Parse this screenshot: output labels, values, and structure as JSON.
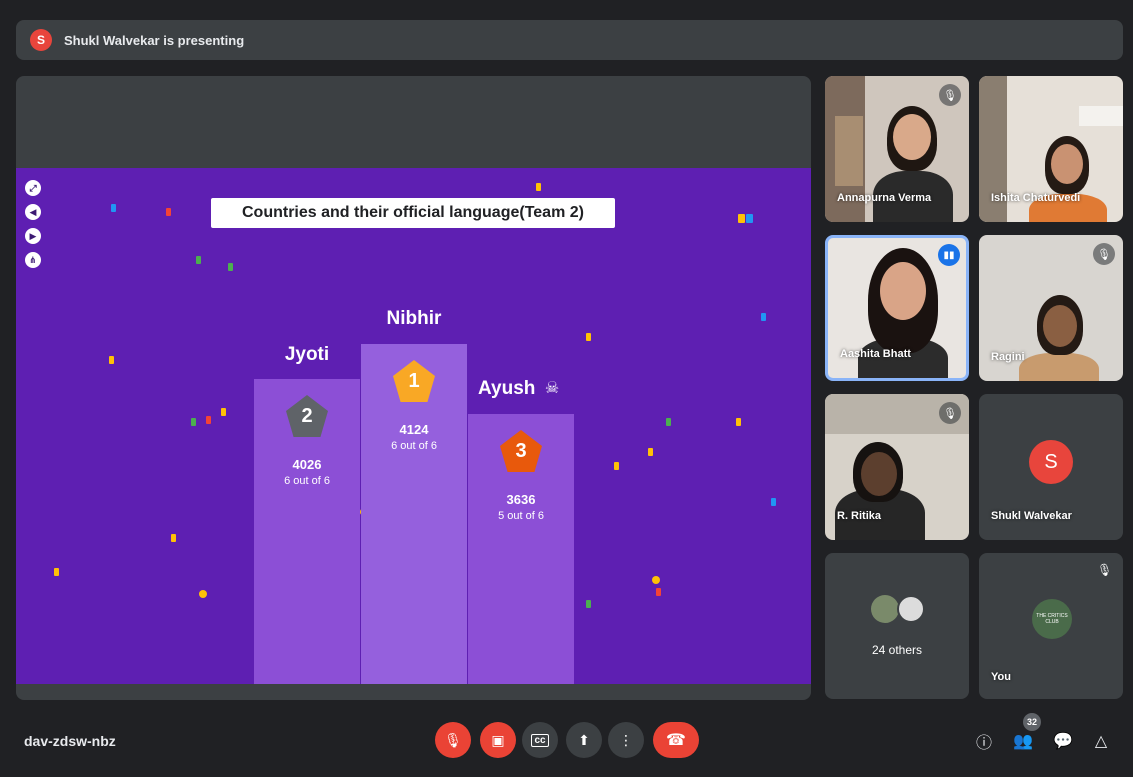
{
  "presenter_bar": {
    "avatar_letter": "S",
    "text": "Shukl Walvekar is presenting"
  },
  "slide": {
    "title": "Countries and their official language(Team 2)",
    "controls": [
      "fullscreen-icon",
      "prev-icon",
      "next-icon",
      "share-icon"
    ],
    "podium": [
      {
        "rank": "2",
        "name": "Jyoti",
        "score": "4026",
        "sub": "6 out of 6",
        "medal_color": "#5f6368"
      },
      {
        "rank": "1",
        "name": "Nibhir",
        "score": "4124",
        "sub": "6 out of 6",
        "medal_color": "#f9a825"
      },
      {
        "rank": "3",
        "name": "Ayush",
        "name_suffix": "☠",
        "score": "3636",
        "sub": "5 out of 6",
        "medal_color": "#e8590c"
      }
    ]
  },
  "participants": [
    {
      "name": "Annapurna Verma",
      "muted": true
    },
    {
      "name": "Ishita Chaturvedi",
      "muted": false
    },
    {
      "name": "Aashita Bhatt",
      "speaking": true
    },
    {
      "name": "Ragini",
      "muted": true
    },
    {
      "name": "R. Ritika",
      "muted": true
    },
    {
      "name": "Shukl Walvekar",
      "avatar_letter": "S",
      "avatar_color": "#e8453c"
    },
    {
      "name": "24 others"
    },
    {
      "name": "You",
      "muted": true,
      "logo_text": "THE CRITICS CLUB"
    }
  ],
  "bottom": {
    "meeting_code": "dav-zdsw-nbz",
    "participant_count": "32",
    "controls": [
      "mic-off-icon",
      "camera-off-icon",
      "captions-icon",
      "present-icon",
      "more-icon",
      "end-call-icon"
    ],
    "right_controls": [
      "info-icon",
      "people-icon",
      "chat-icon",
      "activities-icon"
    ]
  }
}
